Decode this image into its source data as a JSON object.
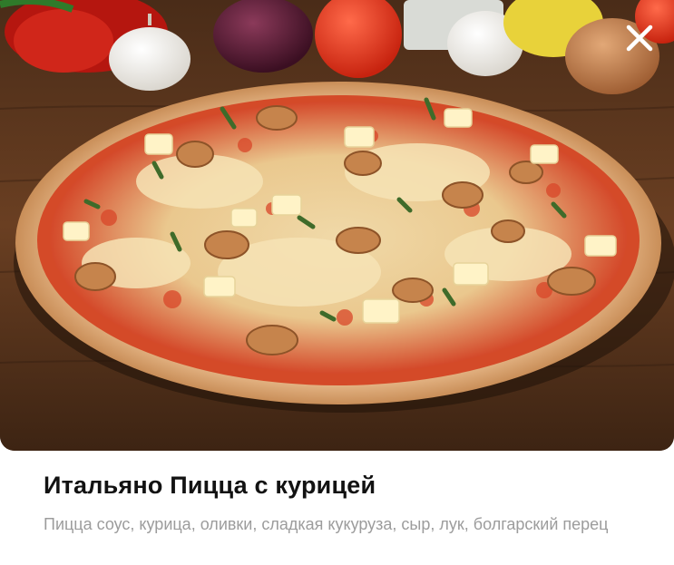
{
  "product": {
    "title": "Итальяно Пицца с курицей",
    "description": "Пицца соус, курица, оливки, сладкая кукуруза, сыр, лук, болгарский перец",
    "image_alt": "pizza-photo"
  },
  "controls": {
    "close_icon": "close-icon"
  },
  "colors": {
    "title": "#121212",
    "description": "#9c9c9c",
    "close_icon": "#ffffff"
  }
}
